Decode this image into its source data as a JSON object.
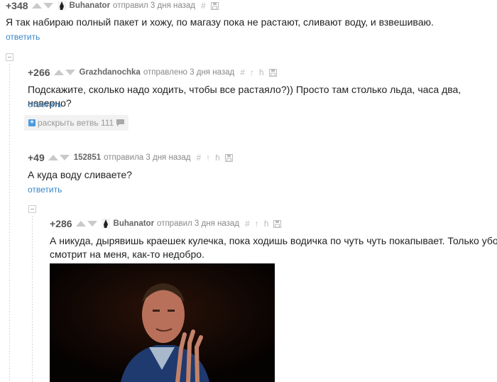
{
  "comments": [
    {
      "rating": "+348",
      "author": "Buhanator",
      "meta": "отправил 3 дня назад",
      "text": "Я так набираю полный пакет и хожу, по магазу пока не растают, сливают воду, и взвешиваю.",
      "reply": "ответить"
    },
    {
      "rating": "+266",
      "author": "Grazhdanochka",
      "meta": "отправлено 3 дня назад",
      "text": "Подскажите, сколько надо ходить, чтобы все растаяло?)) Просто там столько льда, часа два, наверно?",
      "reply": "ответить",
      "expand_label": "раскрыть ветвь 111"
    },
    {
      "rating": "+49",
      "author": "152851",
      "meta": "отправила 3 дня назад",
      "text": "А куда воду сливаете?",
      "reply": "ответить"
    },
    {
      "rating": "+286",
      "author": "Buhanator",
      "meta": "отправил 3 дня назад",
      "text_line1": "А никуда, дырявишь краешек кулечка, пока ходишь водичка по чуть чуть покапывает. Только уборщик",
      "text_line2": "смотрит на меня, как-то недобро."
    }
  ],
  "icons": {
    "hash": "#",
    "parent": "↑",
    "branch": "ɦ"
  }
}
